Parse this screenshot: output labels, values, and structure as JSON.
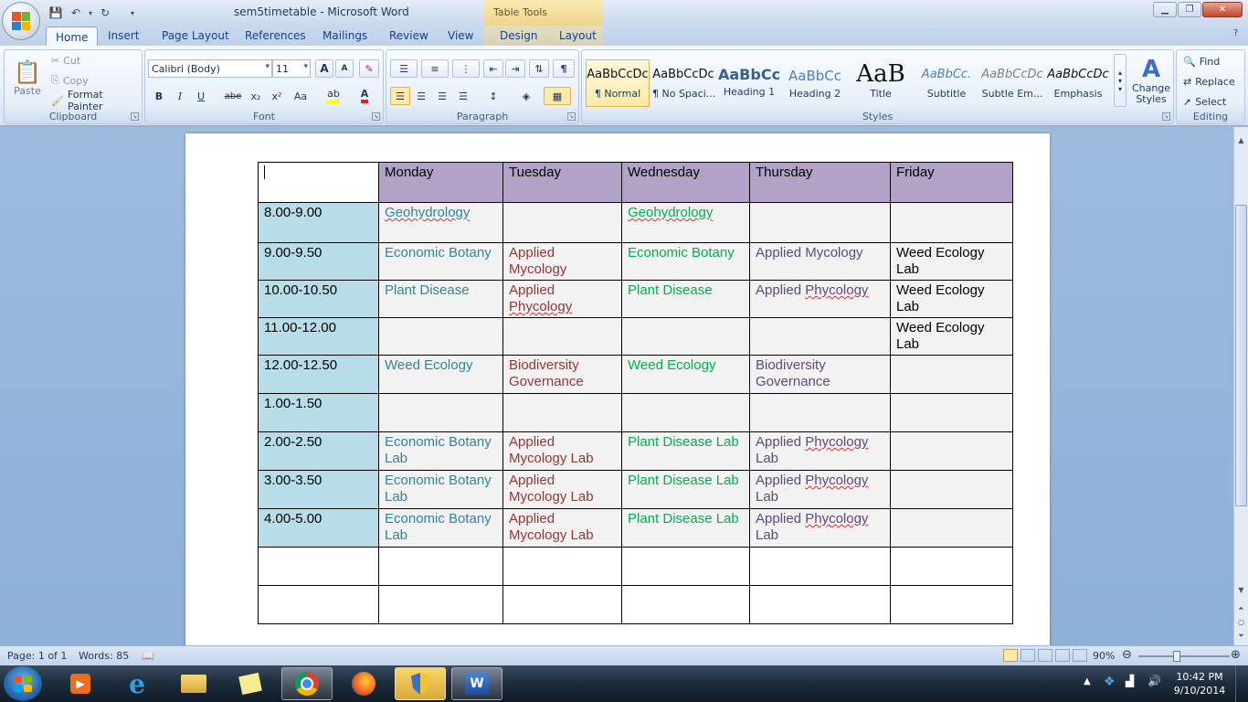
{
  "titlebar": {
    "title": "sem5timetable - Microsoft Word",
    "context_tab_group": "Table Tools"
  },
  "tabs": [
    "Home",
    "Insert",
    "Page Layout",
    "References",
    "Mailings",
    "Review",
    "View",
    "Design",
    "Layout"
  ],
  "ribbon": {
    "clipboard": {
      "label": "Clipboard",
      "paste": "Paste",
      "cut": "Cut",
      "copy": "Copy",
      "format_painter": "Format Painter"
    },
    "font": {
      "label": "Font",
      "font_name": "Calibri (Body)",
      "font_size": "11",
      "bold": "B",
      "italic": "I",
      "underline": "U",
      "strike": "abe",
      "subscript": "x₂",
      "superscript": "x²",
      "change_case": "Aa",
      "grow": "A",
      "shrink": "A"
    },
    "paragraph": {
      "label": "Paragraph",
      "show_marks": "¶"
    },
    "styles": {
      "label": "Styles",
      "items": [
        {
          "sample": "AaBbCcDc",
          "name": "¶ Normal"
        },
        {
          "sample": "AaBbCcDc",
          "name": "¶ No Spaci..."
        },
        {
          "sample": "AaBbCc",
          "name": "Heading 1"
        },
        {
          "sample": "AaBbCc",
          "name": "Heading 2"
        },
        {
          "sample": "AaB",
          "name": "Title"
        },
        {
          "sample": "AaBbCc.",
          "name": "Subtitle"
        },
        {
          "sample": "AaBbCcDc",
          "name": "Subtle Em..."
        },
        {
          "sample": "AaBbCcDc",
          "name": "Emphasis"
        }
      ],
      "change_styles": "Change Styles"
    },
    "editing": {
      "label": "Editing",
      "find": "Find",
      "replace": "Replace",
      "select": "Select"
    }
  },
  "timetable": {
    "days": [
      "Monday",
      "Tuesday",
      "Wednesday",
      "Thursday",
      "Friday"
    ],
    "day_colors": [
      "#31849b",
      "#953735",
      "#00b050",
      "#5f497a",
      "#000000"
    ],
    "rows": [
      {
        "time": "8.00-9.00",
        "cells": [
          "Geohydrology",
          "",
          "Geohydrology",
          "",
          ""
        ]
      },
      {
        "time": "9.00-9.50",
        "cells": [
          "Economic Botany",
          "Applied Mycology",
          "Economic Botany",
          "Applied Mycology",
          "Weed Ecology Lab"
        ]
      },
      {
        "time": "10.00-10.50",
        "cells": [
          "Plant Disease",
          "Applied Phycology",
          "Plant Disease",
          "Applied Phycology",
          "Weed Ecology Lab"
        ]
      },
      {
        "time": "11.00-12.00",
        "cells": [
          "",
          "",
          "",
          "",
          "Weed Ecology Lab"
        ]
      },
      {
        "time": "12.00-12.50",
        "cells": [
          "Weed Ecology",
          "Biodiversity Governance",
          "Weed Ecology",
          "Biodiversity Governance",
          ""
        ]
      },
      {
        "time": "1.00-1.50",
        "cells": [
          "",
          "",
          "",
          "",
          ""
        ]
      },
      {
        "time": "2.00-2.50",
        "cells": [
          "Economic Botany Lab",
          "Applied Mycology Lab",
          "Plant Disease Lab",
          "Applied Phycology Lab",
          ""
        ]
      },
      {
        "time": "3.00-3.50",
        "cells": [
          "Economic Botany Lab",
          "Applied Mycology Lab",
          "Plant Disease Lab",
          "Applied Phycology Lab",
          ""
        ]
      },
      {
        "time": "4.00-5.00",
        "cells": [
          "Economic Botany Lab",
          "Applied Mycology Lab",
          "Plant Disease Lab",
          "Applied Phycology Lab",
          ""
        ]
      }
    ],
    "empty_rows": 2
  },
  "statusbar": {
    "page": "Page: 1 of 1",
    "words": "Words: 85",
    "zoom": "90%"
  },
  "taskbar": {
    "time": "10:42 PM",
    "date": "9/10/2014"
  }
}
